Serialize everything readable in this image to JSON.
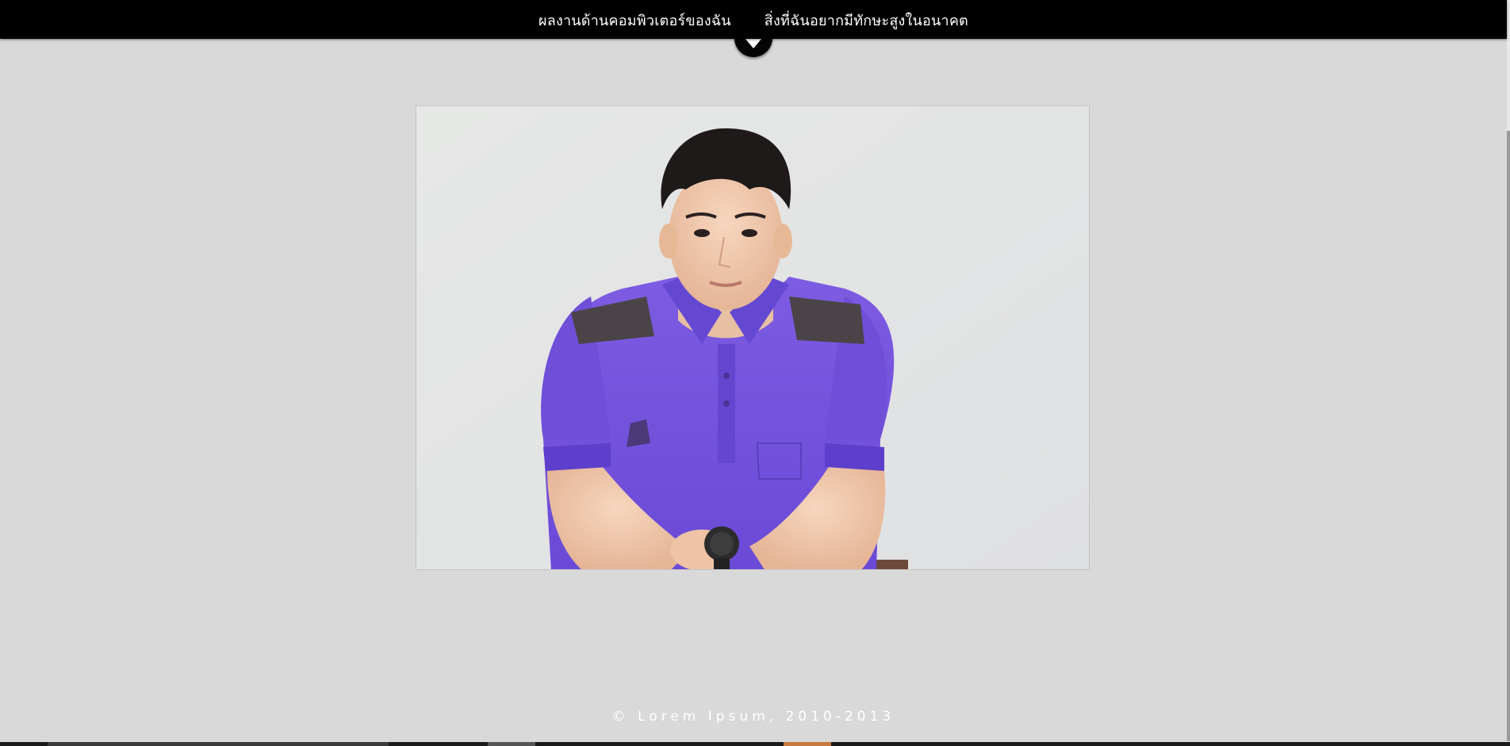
{
  "nav": {
    "items": [
      {
        "label": "ผลงานด้านคอมพิวเตอร์ของฉัน"
      },
      {
        "label": "สิ่งที่ฉันอยากมีทักษะสูงในอนาคต"
      }
    ],
    "toggle_icon": "chevron-down-icon"
  },
  "main": {
    "photo_icon": "portrait-photo"
  },
  "footer": {
    "copyright": "© Lorem Ipsum, 2010-2013"
  },
  "colors": {
    "background": "#d9d9d9",
    "navbar": "#000000",
    "shirt": "#7b5ae0",
    "taskbar_accent": "#c87a40"
  }
}
